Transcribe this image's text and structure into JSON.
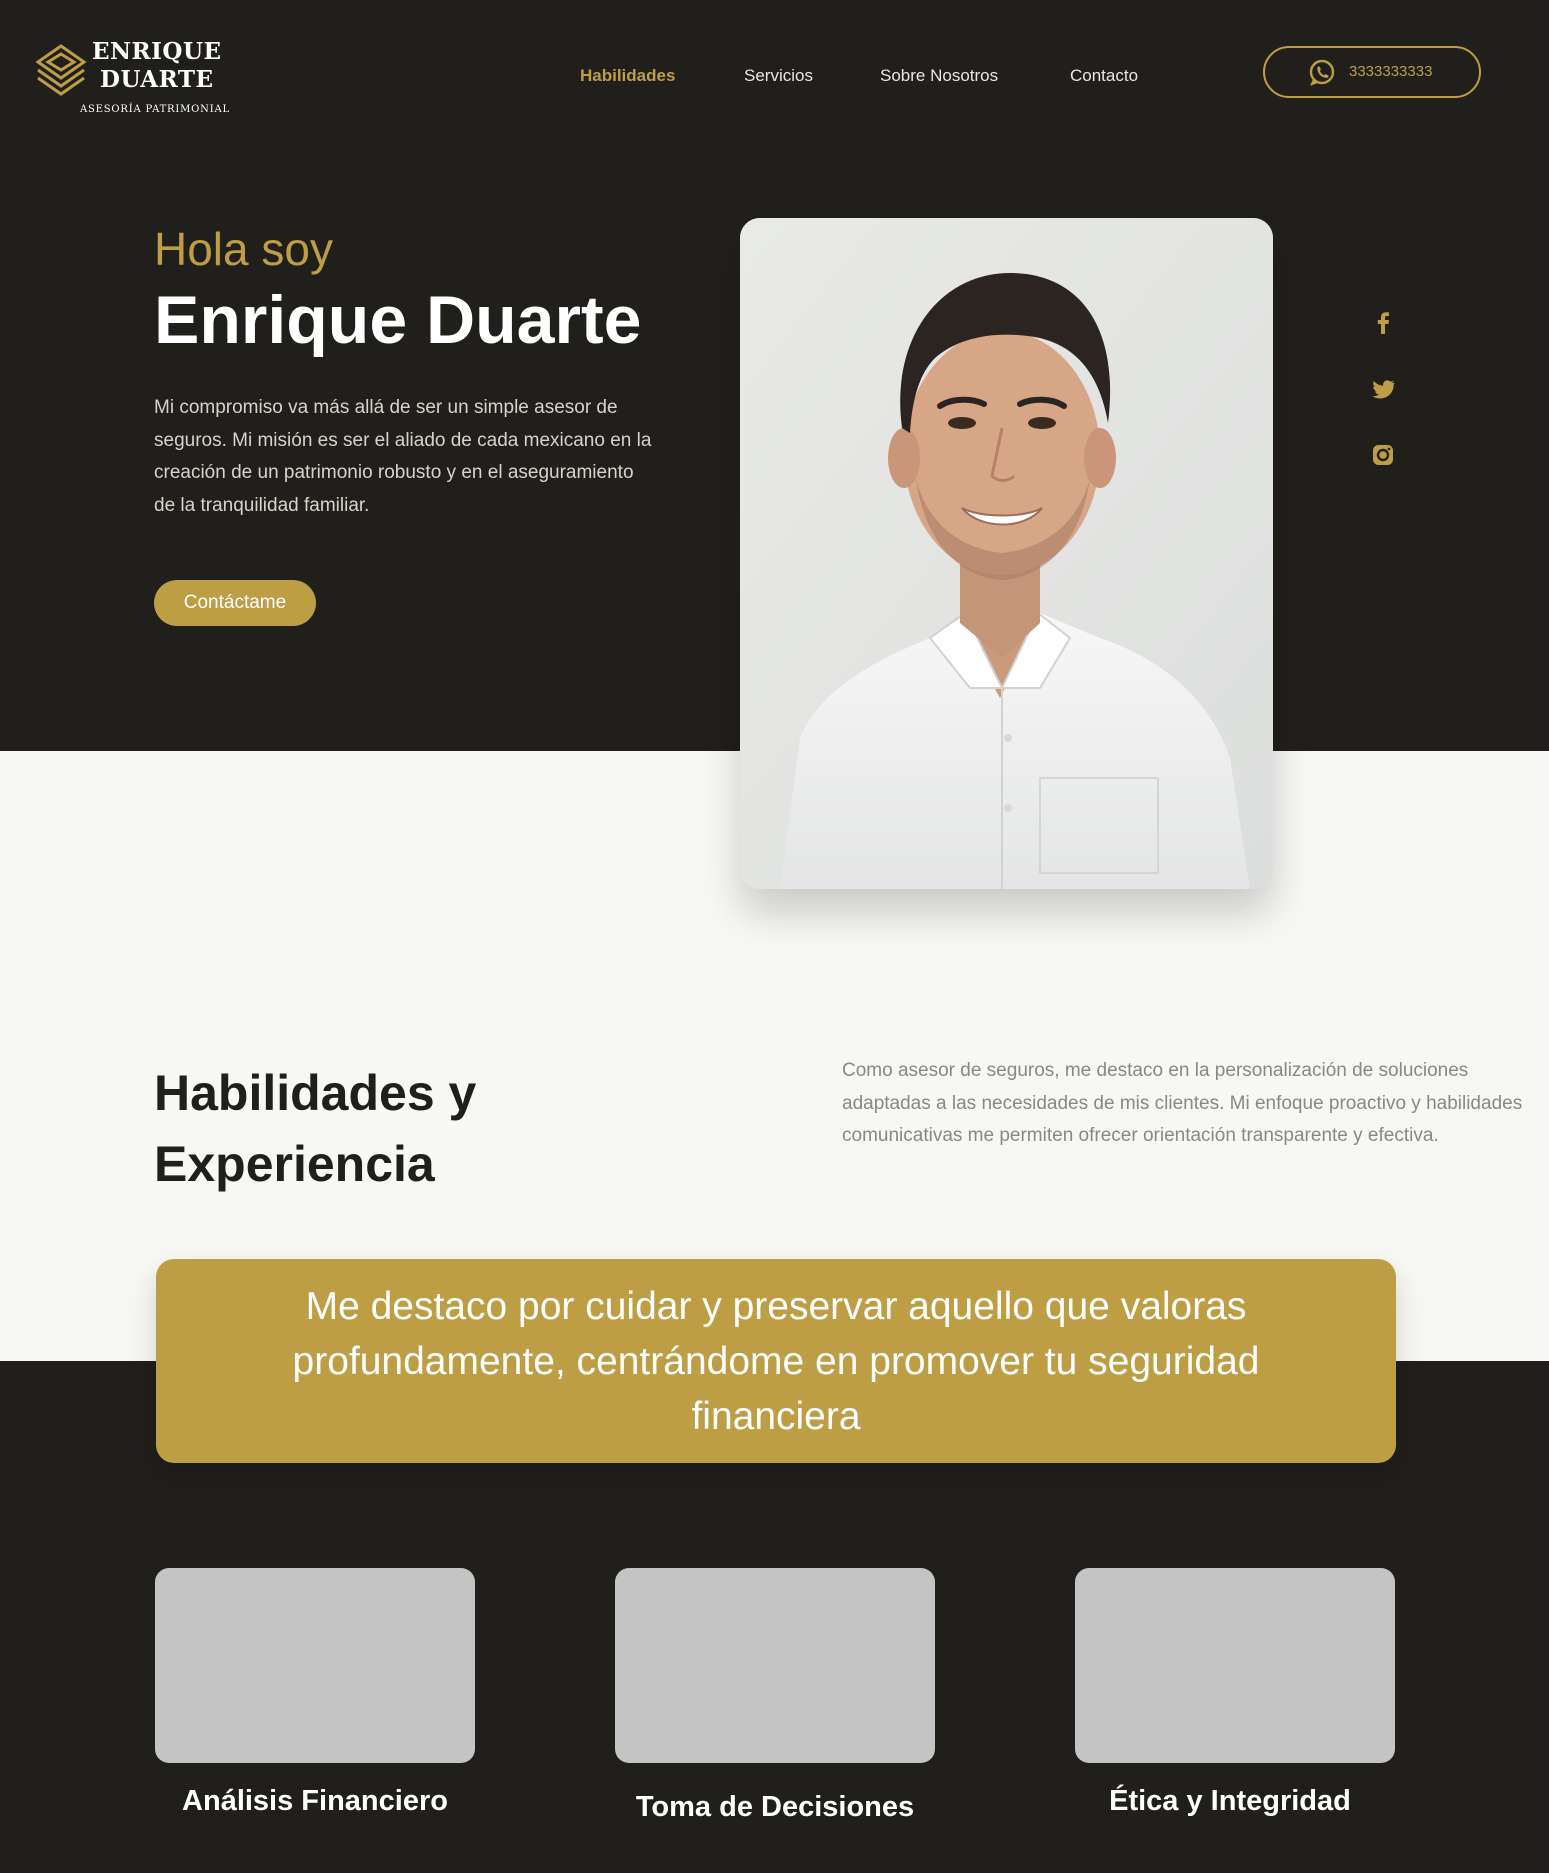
{
  "brand": {
    "name_line1": "ENRIQUE",
    "name_line2": "DUARTE",
    "tagline": "ASESORÍA PATRIMONIAL",
    "gold": "#bd9e45",
    "dark": "#211f1b",
    "light": "#f7f7f4",
    "logo_icon": "layered-diamond-logo-icon"
  },
  "nav": {
    "items": [
      {
        "label": "Habilidades",
        "active": true
      },
      {
        "label": "Servicios",
        "active": false
      },
      {
        "label": "Sobre Nosotros",
        "active": false
      },
      {
        "label": "Contacto",
        "active": false
      }
    ]
  },
  "phone": {
    "icon": "whatsapp-icon",
    "number": "3333333333"
  },
  "hero": {
    "greeting": "Hola soy",
    "name": "Enrique Duarte",
    "description": "Mi compromiso va más allá de ser un simple asesor de seguros. Mi misión es ser el aliado de cada mexicano en la creación de un patrimonio robusto y en el aseguramiento de la tranquilidad familiar.",
    "cta": "Contáctame"
  },
  "social": [
    {
      "icon": "facebook-icon"
    },
    {
      "icon": "twitter-icon"
    },
    {
      "icon": "instagram-icon"
    }
  ],
  "skills": {
    "title": "Habilidades y Experiencia",
    "description": "Como asesor de seguros, me destaco en la personalización de soluciones adaptadas a las necesidades de mis clientes. Mi enfoque proactivo y habilidades comunicativas me permiten ofrecer orientación transparente y efectiva.",
    "banner": "Me destaco por cuidar y preservar aquello que valoras profundamente, centrándome en promover tu seguridad financiera",
    "cards": [
      {
        "label": "Análisis Financiero"
      },
      {
        "label": "Toma de Decisiones"
      },
      {
        "label": "Ética y Integridad"
      }
    ]
  }
}
